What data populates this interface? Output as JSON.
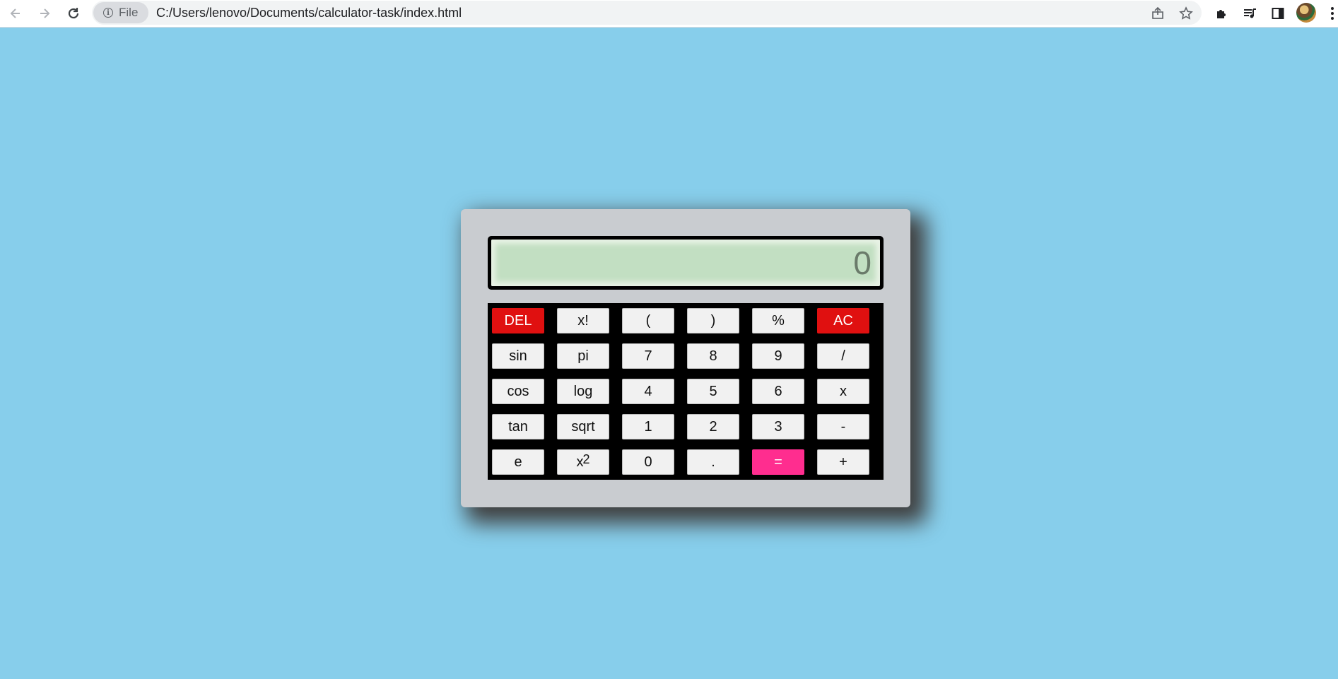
{
  "browser": {
    "site_chip_label": "File",
    "url": "C:/Users/lenovo/Documents/calculator-task/index.html",
    "icons": [
      "back-arrow-icon",
      "forward-arrow-icon",
      "reload-icon",
      "info-icon",
      "share-icon",
      "star-icon",
      "extensions-icon",
      "media-icon",
      "side-panel-icon",
      "avatar",
      "menu-icon"
    ]
  },
  "calculator": {
    "display_value": "0",
    "rows": [
      [
        "DEL",
        "x!",
        "(",
        ")",
        "%",
        "AC"
      ],
      [
        "sin",
        "pi",
        "7",
        "8",
        "9",
        "/"
      ],
      [
        "cos",
        "log",
        "4",
        "5",
        "6",
        "x"
      ],
      [
        "tan",
        "sqrt",
        "1",
        "2",
        "3",
        "-"
      ],
      [
        "e",
        "x",
        "0",
        ".",
        "=",
        "+"
      ]
    ],
    "square_superscript": "2",
    "colors": {
      "page_background": "#87ceeb",
      "body": "#c9ccd0",
      "display": "#c2dfc2",
      "keypad": "#000000",
      "key": "#f1f1f1",
      "danger_keys": "#e01010",
      "equals_key": "#ff2d8f"
    }
  }
}
